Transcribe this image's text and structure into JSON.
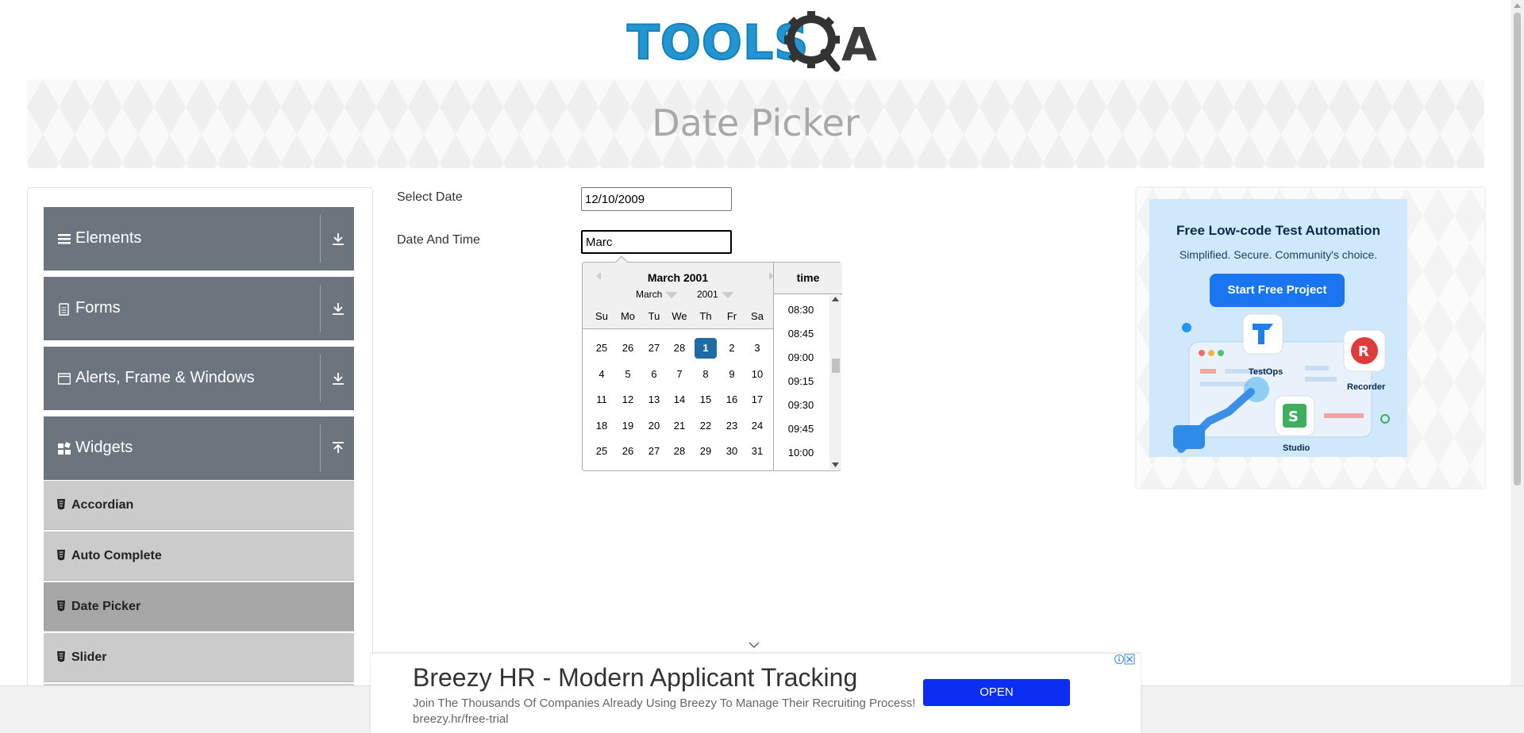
{
  "logo": {
    "part1": "TOOLS",
    "part2": "A"
  },
  "page_title": "Date Picker",
  "sidebar": {
    "groups": [
      {
        "label": "Elements",
        "icon": "hamburger-icon",
        "arrow": "download-icon"
      },
      {
        "label": "Forms",
        "icon": "document-icon",
        "arrow": "download-icon"
      },
      {
        "label": "Alerts, Frame & Windows",
        "icon": "window-icon",
        "arrow": "download-icon"
      },
      {
        "label": "Widgets",
        "icon": "grid-icon",
        "arrow": "upload-icon"
      }
    ],
    "items": [
      {
        "label": "Accordian"
      },
      {
        "label": "Auto Complete"
      },
      {
        "label": "Date Picker",
        "active": true
      },
      {
        "label": "Slider"
      }
    ]
  },
  "form": {
    "select_date_label": "Select Date",
    "select_date_value": "12/10/2009",
    "date_time_label": "Date And Time",
    "date_time_value": "Marc"
  },
  "datepicker": {
    "title": "March 2001",
    "month_select": "March",
    "year_select": "2001",
    "day_names": [
      "Su",
      "Mo",
      "Tu",
      "We",
      "Th",
      "Fr",
      "Sa"
    ],
    "weeks": [
      [
        "25",
        "26",
        "27",
        "28",
        "1",
        "2",
        "3"
      ],
      [
        "4",
        "5",
        "6",
        "7",
        "8",
        "9",
        "10"
      ],
      [
        "11",
        "12",
        "13",
        "14",
        "15",
        "16",
        "17"
      ],
      [
        "18",
        "19",
        "20",
        "21",
        "22",
        "23",
        "24"
      ],
      [
        "25",
        "26",
        "27",
        "28",
        "29",
        "30",
        "31"
      ]
    ],
    "selected_day": "1",
    "time_header": "time",
    "times": [
      "08:30",
      "08:45",
      "09:00",
      "09:15",
      "09:30",
      "09:45",
      "10:00"
    ]
  },
  "ad_right": {
    "headline": "Free Low-code Test Automation",
    "subline": "Simplified. Secure. Community's choice.",
    "button": "Start Free Project",
    "labels": {
      "testops": "TestOps",
      "recorder": "Recorder",
      "studio": "Studio"
    }
  },
  "ad_bottom": {
    "title": "Breezy HR - Modern Applicant Tracking",
    "description": "Join The Thousands Of Companies Already Using Breezy To Manage Their Recruiting Process! breezy.hr/free-trial",
    "button": "OPEN"
  },
  "colors": {
    "sidebar_group": "#6c757d",
    "selected_day": "#216ba5",
    "ad_button": "#1976f0",
    "bottom_ad_button": "#0b2ef0"
  }
}
